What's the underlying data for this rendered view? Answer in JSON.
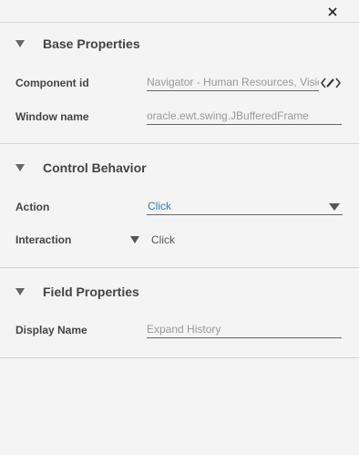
{
  "panel": {
    "close_icon": "close-icon",
    "sections": {
      "base": {
        "title": "Base Properties",
        "component_id_label": "Component id",
        "component_id_value": "Navigator - Human Resources, Visio",
        "window_name_label": "Window name",
        "window_name_value": "oracle.ewt.swing.JBufferedFrame"
      },
      "control": {
        "title": "Control Behavior",
        "action_label": "Action",
        "action_value": "Click",
        "interaction_label": "Interaction",
        "interaction_value": "Click"
      },
      "field": {
        "title": "Field Properties",
        "display_name_label": "Display Name",
        "display_name_value": "Expand History"
      }
    }
  },
  "colors": {
    "background": "#f4f4f4",
    "link": "#2a7fb8",
    "divider": "#d4d4d4"
  }
}
